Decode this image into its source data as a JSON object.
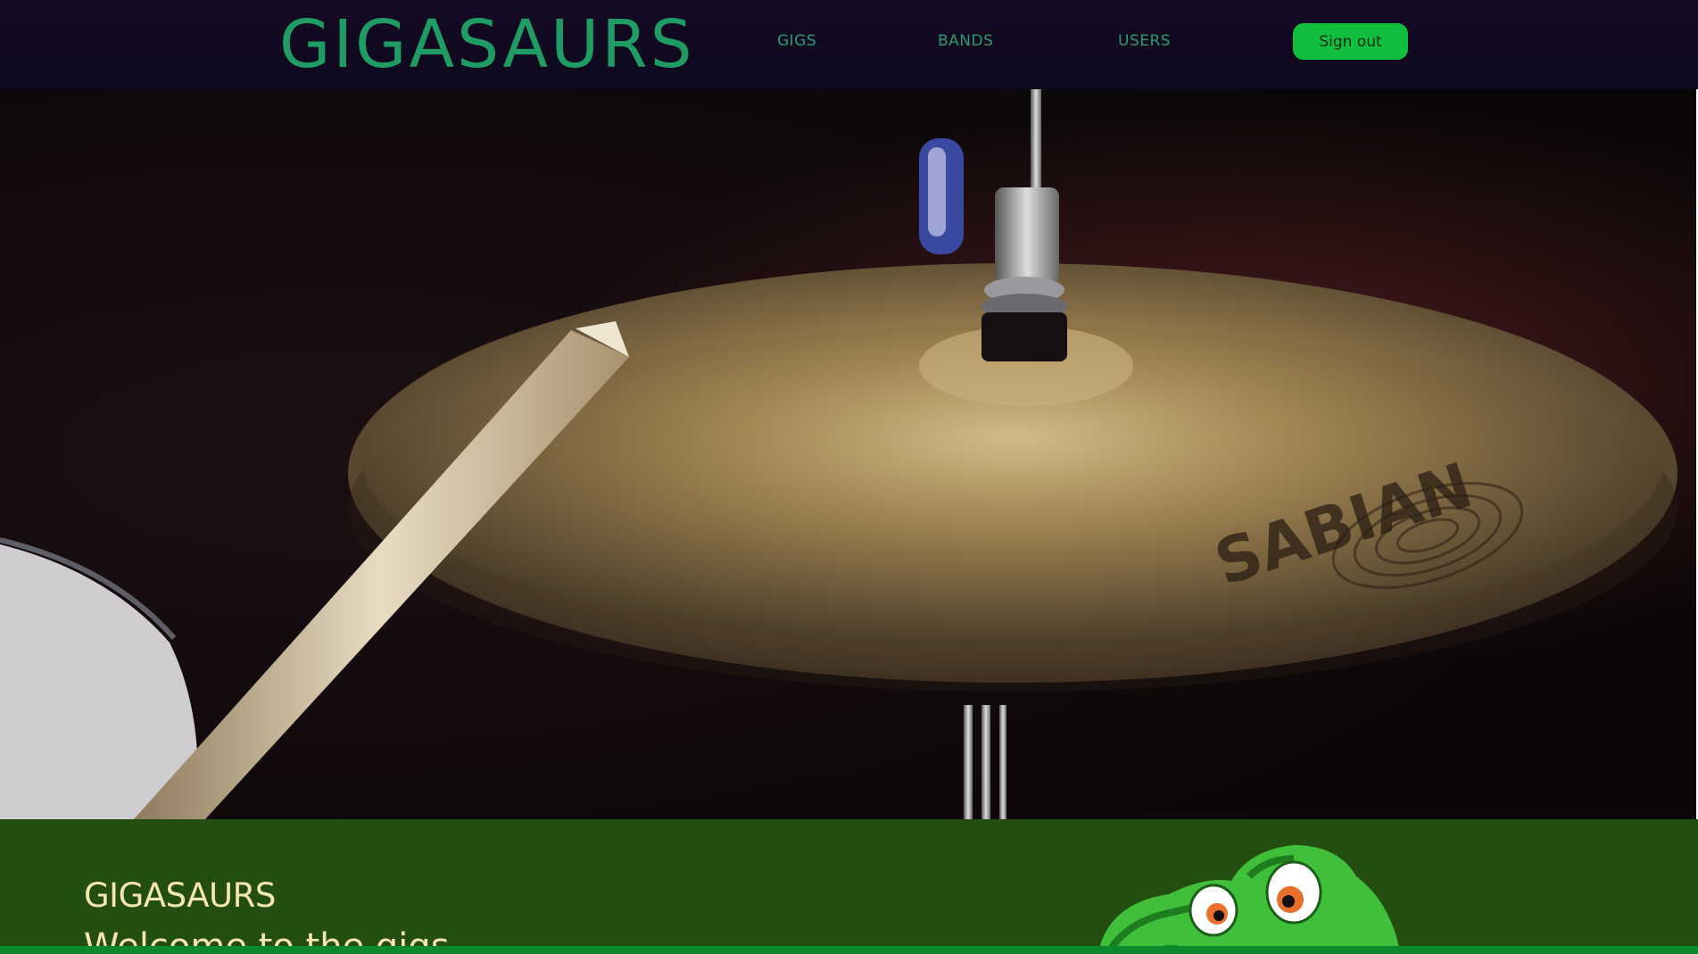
{
  "header": {
    "brand": "GIGASAURS",
    "nav": {
      "gigs": "GIGS",
      "bands": "BANDS",
      "users": "USERS"
    },
    "sign_out_label": "Sign out"
  },
  "hero": {
    "image_icon": "cymbal-photo",
    "cymbal_brand_text": "SABIAN"
  },
  "intro": {
    "title": "GIGASAURS",
    "subtitle": "Welcome to the gigs"
  },
  "colors": {
    "nav_background": "#0d0a1f",
    "brand_green": "#1f9c63",
    "signout_green": "#0fbf3d",
    "section_green": "#244e10",
    "heading_cream": "#f5e6b0"
  }
}
